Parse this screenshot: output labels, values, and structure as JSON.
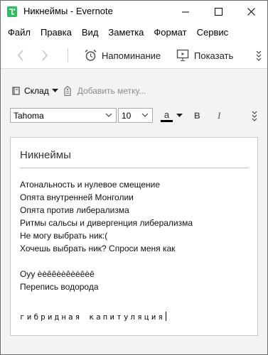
{
  "window": {
    "title": "Никнеймы - Evernote"
  },
  "menu": [
    "Файл",
    "Правка",
    "Вид",
    "Заметка",
    "Формат",
    "Сервис"
  ],
  "toolbar": {
    "reminder_label": "Напоминание",
    "show_label": "Показать"
  },
  "note_meta": {
    "notebook": "Склад",
    "tag_placeholder": "Добавить метку..."
  },
  "format": {
    "font": "Tahoma",
    "size": "10",
    "color_letter": "a",
    "bold_label": "B",
    "italic_label": "I"
  },
  "note": {
    "title": "Никнеймы",
    "lines": [
      "Атональность и нулевое смещение",
      "Опята внутренней Монголии",
      "Опята против либерализма",
      "Ритмы сальсы и дивергенция либерализма",
      "Не могу выбрать ник:(",
      "Хочешь выбрать ник? Спроси меня как",
      "",
      "Оуу èèêêèèêèèêèê",
      "Перепись водорода",
      "",
      "гибридная капитуляция"
    ]
  }
}
